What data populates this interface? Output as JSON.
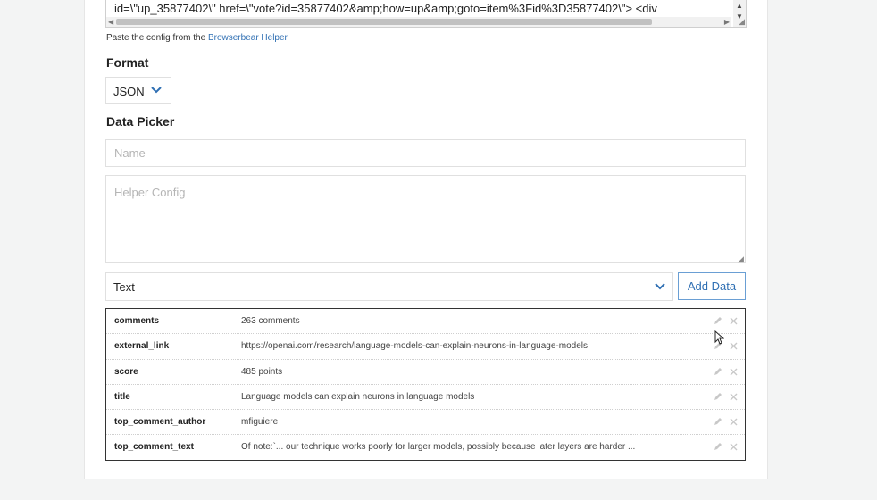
{
  "code_box": {
    "text": "id=\\\"up_35877402\\\" href=\\\"vote?id=35877402&amp;how=up&amp;goto=item%3Fid%3D35877402\\\"> <div"
  },
  "hint": {
    "prefix": "Paste the config from the ",
    "link": "Browserbear Helper"
  },
  "format": {
    "label": "Format",
    "value": "JSON"
  },
  "data_picker": {
    "label": "Data Picker",
    "name_placeholder": "Name",
    "helper_placeholder": "Helper Config",
    "type_value": "Text",
    "add_button": "Add Data"
  },
  "rows": [
    {
      "key": "comments",
      "value": "263 comments"
    },
    {
      "key": "external_link",
      "value": "https://openai.com/research/language-models-can-explain-neurons-in-language-models"
    },
    {
      "key": "score",
      "value": "485 points"
    },
    {
      "key": "title",
      "value": "Language models can explain neurons in language models"
    },
    {
      "key": "top_comment_author",
      "value": "mfiguiere"
    },
    {
      "key": "top_comment_text",
      "value": "Of note:`... our technique works poorly for larger models, possibly because later layers are harder ..."
    }
  ],
  "icons": {
    "edit": "pencil-icon",
    "delete": "close-icon",
    "dropdown": "chevron-down-icon"
  },
  "colors": {
    "link": "#2f6fb3",
    "button_border": "#6a9fd4"
  }
}
